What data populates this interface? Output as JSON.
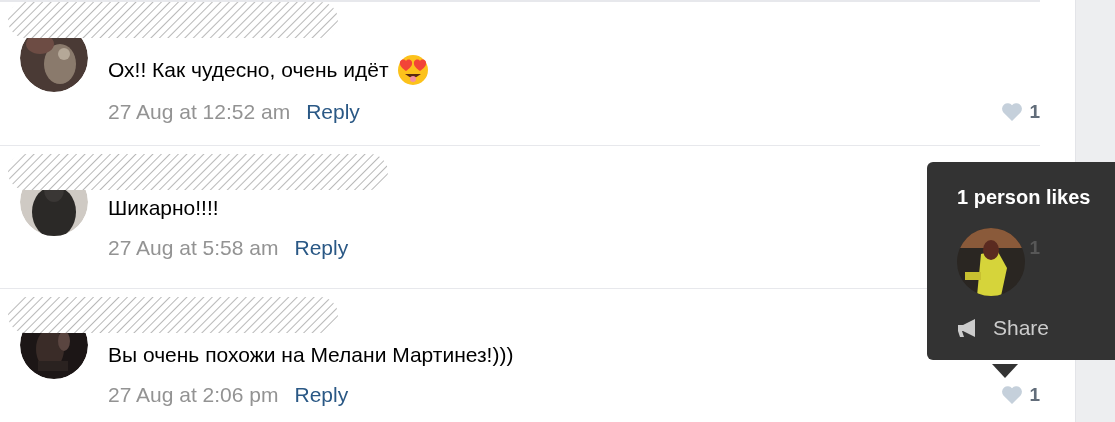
{
  "comments": [
    {
      "text": "Ох!! Как чудесно, очень идёт",
      "emoji": true,
      "date": "27 Aug at 12:52 am",
      "reply": "Reply",
      "likes": "1",
      "heart": true
    },
    {
      "text": "Шикарно!!!!",
      "emoji": false,
      "date": "27 Aug at 5:58 am",
      "reply": "Reply",
      "likes": "1",
      "heart": false
    },
    {
      "text": "Вы очень похожи на Мелани Мартинез!)))",
      "emoji": false,
      "date": "27 Aug at 2:06 pm",
      "reply": "Reply",
      "likes": "1",
      "heart": true
    }
  ],
  "tooltip": {
    "title": "1 person likes",
    "share": "Share"
  }
}
